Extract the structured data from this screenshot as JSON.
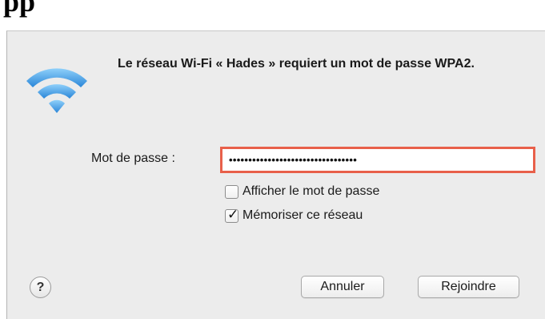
{
  "heading_fragment": "pp",
  "dialog": {
    "message": "Le réseau Wi-Fi « Hades » requiert un mot de passe WPA2.",
    "password_label": "Mot de passe :",
    "password_value": "•••••••••••••••••••••••••••••••••",
    "show_password_label": "Afficher le mot de passe",
    "show_password_checked": false,
    "remember_network_label": "Mémoriser ce réseau",
    "remember_network_checked": true,
    "checkmark_glyph": "✓",
    "help_label": "?",
    "cancel_label": "Annuler",
    "join_label": "Rejoindre"
  },
  "icons": {
    "network": "wifi-icon",
    "help": "question-mark-icon",
    "check": "checkmark-icon"
  },
  "colors": {
    "password_field_highlight": "#e8604a",
    "wifi_blue_light": "#7fc4f4",
    "wifi_blue_dark": "#2a86d8",
    "dialog_background": "#ececec"
  }
}
